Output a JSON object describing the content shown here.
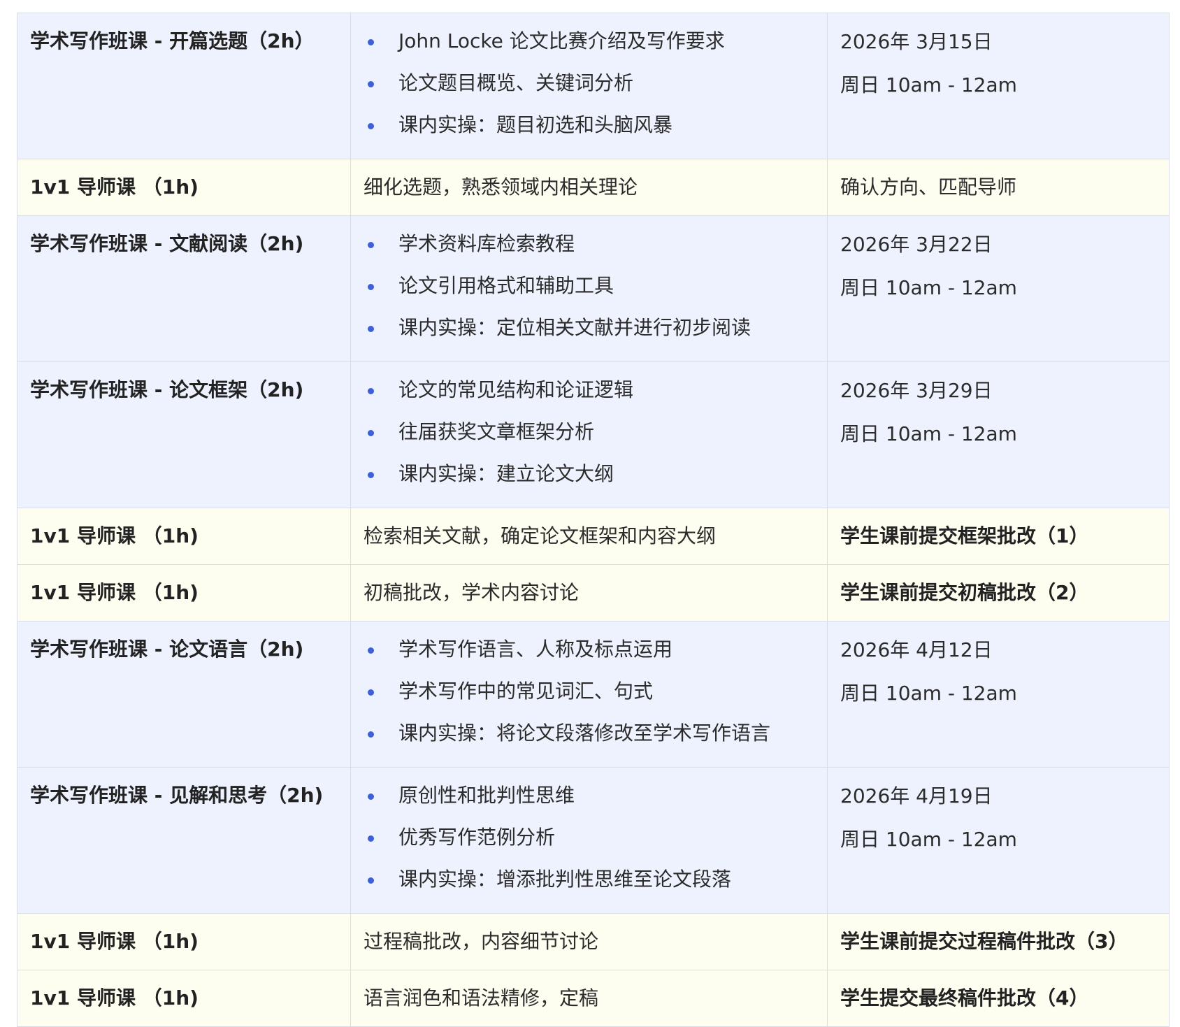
{
  "rows": [
    {
      "type": "class",
      "title": "学术写作班课 - 开篇选题（2h）",
      "items": [
        "John Locke 论文比赛介绍及写作要求",
        "论文题目概览、关键词分析",
        "课内实操：题目初选和头脑风暴"
      ],
      "date": "2026年 3月15日",
      "time": "周日 10am - 12am"
    },
    {
      "type": "tutor",
      "title": "1v1 导师课 （1h)",
      "content": "细化选题，熟悉领域内相关理论",
      "note": "确认方向、匹配导师",
      "note_bold": false
    },
    {
      "type": "class",
      "title": "学术写作班课 - 文献阅读（2h)",
      "items": [
        "学术资料库检索教程",
        "论文引用格式和辅助工具",
        "课内实操：定位相关文献并进行初步阅读"
      ],
      "date": "2026年 3月22日",
      "time": "周日 10am - 12am"
    },
    {
      "type": "class",
      "title": "学术写作班课 - 论文框架（2h)",
      "items": [
        "论文的常见结构和论证逻辑",
        "往届获奖文章框架分析",
        "课内实操：建立论文大纲"
      ],
      "date": "2026年 3月29日",
      "time": "周日 10am - 12am"
    },
    {
      "type": "tutor",
      "title": "1v1 导师课 （1h)",
      "content": "检索相关文献，确定论文框架和内容大纲",
      "note": "学生课前提交框架批改（1）",
      "note_bold": true
    },
    {
      "type": "tutor",
      "title": "1v1 导师课 （1h)",
      "content": "初稿批改，学术内容讨论",
      "note": "学生课前提交初稿批改（2）",
      "note_bold": true
    },
    {
      "type": "class",
      "title": "学术写作班课 - 论文语言（2h)",
      "items": [
        "学术写作语言、人称及标点运用",
        "学术写作中的常见词汇、句式",
        "课内实操：将论文段落修改至学术写作语言"
      ],
      "date": "2026年 4月12日",
      "time": "周日 10am - 12am"
    },
    {
      "type": "class",
      "title": "学术写作班课 - 见解和思考（2h)",
      "items": [
        "原创性和批判性思维",
        "优秀写作范例分析",
        "课内实操：增添批判性思维至论文段落"
      ],
      "date": "2026年 4月19日",
      "time": "周日 10am - 12am"
    },
    {
      "type": "tutor",
      "title": "1v1 导师课 （1h)",
      "content": "过程稿批改，内容细节讨论",
      "note": "学生课前提交过程稿件批改（3）",
      "note_bold": true
    },
    {
      "type": "tutor",
      "title": "1v1 导师课 （1h)",
      "content": "语言润色和语法精修，定稿",
      "note": "学生提交最终稿件批改（4）",
      "note_bold": true
    }
  ],
  "colors": {
    "class_row_bg": "#eef2fe",
    "tutor_row_bg": "#fdfdf0",
    "bullet": "#3d5fd9",
    "border": "#d9dde6"
  }
}
